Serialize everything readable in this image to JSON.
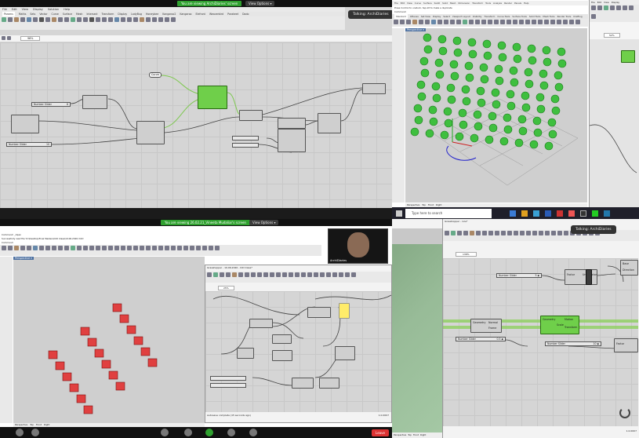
{
  "q1": {
    "banner": "You are viewing ArchiDiaries' screen",
    "view_options": "View Options ▾",
    "talking": "Talking: ArchiDiaries",
    "menu": [
      "File",
      "Edit",
      "View",
      "Display",
      "Solution",
      "Help"
    ],
    "tabs": [
      "Params",
      "Maths",
      "Sets",
      "Vector",
      "Curve",
      "Surface",
      "Mesh",
      "Intersect",
      "Transform",
      "Display",
      "LadyBug",
      "Honeybee",
      "Kangaroo2",
      "Kangaroo",
      "Elefront",
      "Weaverbird",
      "Parakeet",
      "Dodo"
    ],
    "zoom": "96%",
    "sliders": [
      {
        "label": "Number Slider",
        "value": "8"
      },
      {
        "label": "Number Slider",
        "value": "10"
      }
    ],
    "panel": "Curve"
  },
  "q2": {
    "menu": [
      "File",
      "Edit",
      "View",
      "Curve",
      "Surface",
      "SubD",
      "Solid",
      "Mesh",
      "Dimension",
      "Transform",
      "Tools",
      "Analyze",
      "Render",
      "Panels",
      "Help"
    ],
    "command_hint": "Press Control to unstuck, tap Alt to make a duplicate",
    "command": "Command:",
    "tabs": [
      "Standard",
      "CPlanes",
      "Set View",
      "Display",
      "Select",
      "Viewport Layout",
      "Visibility",
      "Transform",
      "Curve Tools",
      "Surface Tools",
      "Solid Tools",
      "Mesh Tools",
      "Render Tools",
      "Drafting"
    ],
    "viewport": "Perspective ▾",
    "view_tabs": [
      "Perspective",
      "Top",
      "Front",
      "Right"
    ],
    "search": "Type here to search",
    "right_menu": [
      "File",
      "Edit",
      "View",
      "Display",
      "Solution",
      "Help"
    ],
    "right_zoom": "52%"
  },
  "q3": {
    "banner": "You are viewing 26.02.21_Vineeta Mudaliar's screen",
    "view_options": "View Options ▾",
    "title": "Grasshopper - FK-Class",
    "command1": "Successfully read file 'D:\\Desktop\\Final Masters\\ICD Class\\19.06.2020.3dm'",
    "command2": "Command: _Open",
    "command3": "Command:",
    "viewport": "Perspective ▾",
    "gh_title": "Grasshopper - 19.06.2020 - ICD Class*",
    "gh_zoom": "25%",
    "status": "Autosave complete (15 seconds ago)",
    "version": "1.0.0007",
    "view_tabs": [
      "Perspective",
      "Top",
      "Front",
      "Right"
    ],
    "participant": "ArchiDiaries",
    "leave": "Leave"
  },
  "q4": {
    "talking": "Talking: ArchiDiaries",
    "gh_title": "Grasshopper - rule*",
    "zoom": "138%",
    "sliders": [
      {
        "label": "Number Slider",
        "value": "5 ◆"
      },
      {
        "label": "Number Slider",
        "value": "0.5 ◆"
      },
      {
        "label": "Number Slider",
        "value": "10 ◆"
      }
    ],
    "components": [
      "Factor",
      "Unit vector",
      "Geometry",
      "Normal",
      "Frame",
      "Geometry",
      "Motion",
      "Transform",
      "Scale",
      "Factor",
      "Base",
      "Direction"
    ],
    "view_tabs": [
      "Perspective",
      "Top",
      "Front",
      "Right"
    ],
    "version": "1.0.0007"
  },
  "colors": {
    "accent_green": "#2fa12f",
    "canvas": "#d5d5d5",
    "sphere": "#3fbf3f",
    "box": "#e04040"
  }
}
